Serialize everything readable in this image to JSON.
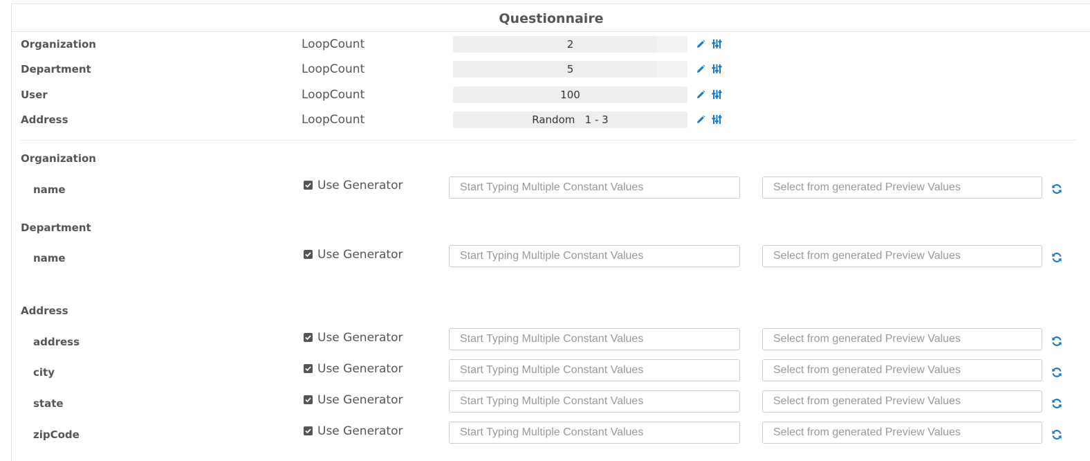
{
  "header": {
    "title": "Questionnaire"
  },
  "loops": [
    {
      "entity": "Organization",
      "type": "LoopCount",
      "value": "2"
    },
    {
      "entity": "Department",
      "type": "LoopCount",
      "value": "5"
    },
    {
      "entity": "User",
      "type": "LoopCount",
      "value": "100"
    },
    {
      "entity": "Address",
      "type": "LoopCount",
      "value": "Random   1 - 3"
    }
  ],
  "sections": [
    {
      "title": "Organization",
      "fields": [
        {
          "name": "name"
        }
      ]
    },
    {
      "title": "Department",
      "fields": [
        {
          "name": "name"
        }
      ]
    },
    {
      "title": "Address",
      "fields": [
        {
          "name": "address"
        },
        {
          "name": "city"
        },
        {
          "name": "state"
        },
        {
          "name": "zipCode"
        }
      ]
    }
  ],
  "field_controls": {
    "generator_label": "Use Generator",
    "generator_checked": true,
    "constant_placeholder": "Start Typing Multiple Constant Values",
    "preview_placeholder": "Select from generated Preview Values"
  },
  "colors": {
    "accent": "#1a7bc4",
    "text": "#555555",
    "loop_bg": "#eeeeee"
  },
  "icons": {
    "edit": "pencil-icon",
    "settings": "sliders-icon",
    "refresh": "refresh-icon"
  }
}
